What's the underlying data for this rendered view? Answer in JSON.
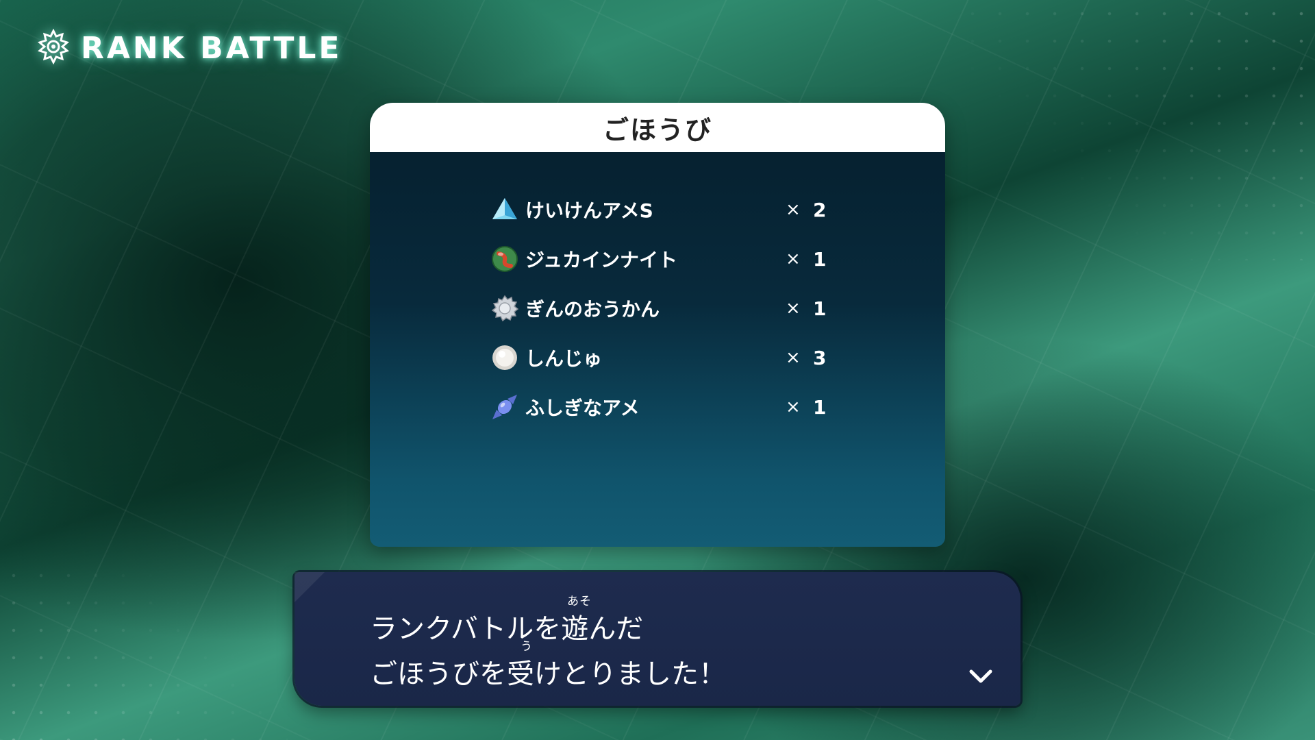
{
  "header": {
    "title": "RANK BATTLE",
    "icon": "rank-battle-emblem-icon"
  },
  "rewards_panel": {
    "title": "ごほうび",
    "times_symbol": "×",
    "items": [
      {
        "name": "けいけんアメS",
        "qty": "2",
        "icon": "exp-candy-icon"
      },
      {
        "name": "ジュカインナイト",
        "qty": "1",
        "icon": "sceptilite-icon"
      },
      {
        "name": "ぎんのおうかん",
        "qty": "1",
        "icon": "silver-crown-icon"
      },
      {
        "name": "しんじゅ",
        "qty": "3",
        "icon": "pearl-icon"
      },
      {
        "name": "ふしぎなアメ",
        "qty": "1",
        "icon": "rare-candy-icon"
      }
    ]
  },
  "message": {
    "line1": "ランクバトルを遊んだ",
    "line2": "ごほうびを受けとりました！",
    "ruby1": "あそ",
    "ruby2": "う",
    "advance_icon": "chevron-down-icon"
  }
}
